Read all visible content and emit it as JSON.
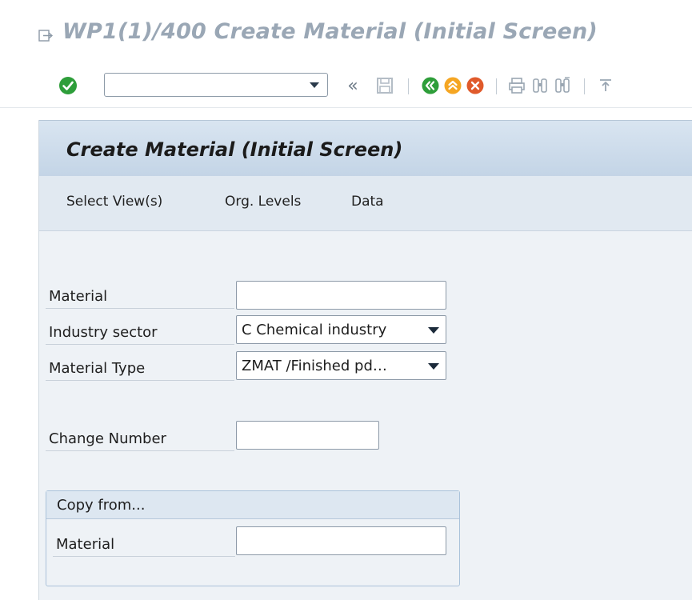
{
  "window": {
    "title": "WP1(1)/400 Create Material (Initial Screen)"
  },
  "toolbar": {
    "icons": [
      "enter-icon",
      "command-field",
      "collapse-icon",
      "save-icon",
      "back-icon",
      "exit-icon",
      "cancel-icon",
      "print-icon",
      "find-icon",
      "find-next-icon",
      "first-page-icon"
    ],
    "collapse_label": "«",
    "command_value": ""
  },
  "screen": {
    "title": "Create Material (Initial Screen)",
    "menu": [
      "Select View(s)",
      "Org. Levels",
      "Data"
    ]
  },
  "fields": {
    "material": {
      "label": "Material",
      "value": ""
    },
    "industry_sector": {
      "label": "Industry sector",
      "value": "C Chemical industry"
    },
    "material_type": {
      "label": "Material Type",
      "value": "ZMAT /Finished pd…"
    },
    "change_number": {
      "label": "Change Number",
      "value": ""
    }
  },
  "copy_from": {
    "title": "Copy from...",
    "material_label": "Material",
    "material_value": ""
  },
  "colors": {
    "title_text": "#9aa7b5",
    "panel_bg": "#eef2f6",
    "header_bg": "#c3d4e6",
    "enter_green": "#2e9e3a",
    "back_green": "#2e9e3a",
    "exit_orange": "#f5a623",
    "cancel_red": "#e05a2b"
  }
}
